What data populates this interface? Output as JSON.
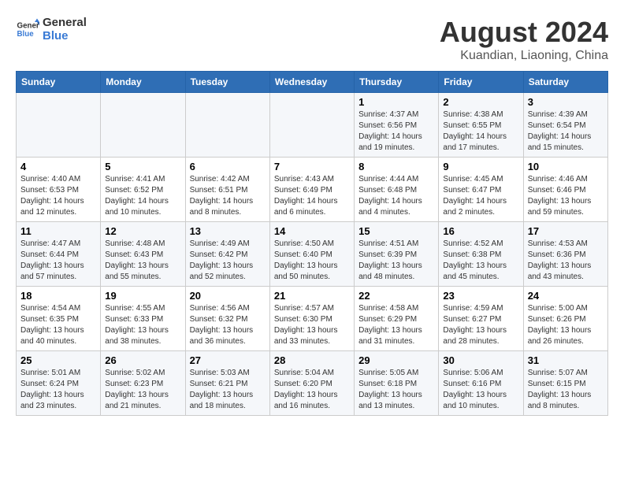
{
  "header": {
    "logo_line1": "General",
    "logo_line2": "Blue",
    "month_title": "August 2024",
    "location": "Kuandian, Liaoning, China"
  },
  "weekdays": [
    "Sunday",
    "Monday",
    "Tuesday",
    "Wednesday",
    "Thursday",
    "Friday",
    "Saturday"
  ],
  "weeks": [
    [
      {
        "day": "",
        "info": ""
      },
      {
        "day": "",
        "info": ""
      },
      {
        "day": "",
        "info": ""
      },
      {
        "day": "",
        "info": ""
      },
      {
        "day": "1",
        "info": "Sunrise: 4:37 AM\nSunset: 6:56 PM\nDaylight: 14 hours\nand 19 minutes."
      },
      {
        "day": "2",
        "info": "Sunrise: 4:38 AM\nSunset: 6:55 PM\nDaylight: 14 hours\nand 17 minutes."
      },
      {
        "day": "3",
        "info": "Sunrise: 4:39 AM\nSunset: 6:54 PM\nDaylight: 14 hours\nand 15 minutes."
      }
    ],
    [
      {
        "day": "4",
        "info": "Sunrise: 4:40 AM\nSunset: 6:53 PM\nDaylight: 14 hours\nand 12 minutes."
      },
      {
        "day": "5",
        "info": "Sunrise: 4:41 AM\nSunset: 6:52 PM\nDaylight: 14 hours\nand 10 minutes."
      },
      {
        "day": "6",
        "info": "Sunrise: 4:42 AM\nSunset: 6:51 PM\nDaylight: 14 hours\nand 8 minutes."
      },
      {
        "day": "7",
        "info": "Sunrise: 4:43 AM\nSunset: 6:49 PM\nDaylight: 14 hours\nand 6 minutes."
      },
      {
        "day": "8",
        "info": "Sunrise: 4:44 AM\nSunset: 6:48 PM\nDaylight: 14 hours\nand 4 minutes."
      },
      {
        "day": "9",
        "info": "Sunrise: 4:45 AM\nSunset: 6:47 PM\nDaylight: 14 hours\nand 2 minutes."
      },
      {
        "day": "10",
        "info": "Sunrise: 4:46 AM\nSunset: 6:46 PM\nDaylight: 13 hours\nand 59 minutes."
      }
    ],
    [
      {
        "day": "11",
        "info": "Sunrise: 4:47 AM\nSunset: 6:44 PM\nDaylight: 13 hours\nand 57 minutes."
      },
      {
        "day": "12",
        "info": "Sunrise: 4:48 AM\nSunset: 6:43 PM\nDaylight: 13 hours\nand 55 minutes."
      },
      {
        "day": "13",
        "info": "Sunrise: 4:49 AM\nSunset: 6:42 PM\nDaylight: 13 hours\nand 52 minutes."
      },
      {
        "day": "14",
        "info": "Sunrise: 4:50 AM\nSunset: 6:40 PM\nDaylight: 13 hours\nand 50 minutes."
      },
      {
        "day": "15",
        "info": "Sunrise: 4:51 AM\nSunset: 6:39 PM\nDaylight: 13 hours\nand 48 minutes."
      },
      {
        "day": "16",
        "info": "Sunrise: 4:52 AM\nSunset: 6:38 PM\nDaylight: 13 hours\nand 45 minutes."
      },
      {
        "day": "17",
        "info": "Sunrise: 4:53 AM\nSunset: 6:36 PM\nDaylight: 13 hours\nand 43 minutes."
      }
    ],
    [
      {
        "day": "18",
        "info": "Sunrise: 4:54 AM\nSunset: 6:35 PM\nDaylight: 13 hours\nand 40 minutes."
      },
      {
        "day": "19",
        "info": "Sunrise: 4:55 AM\nSunset: 6:33 PM\nDaylight: 13 hours\nand 38 minutes."
      },
      {
        "day": "20",
        "info": "Sunrise: 4:56 AM\nSunset: 6:32 PM\nDaylight: 13 hours\nand 36 minutes."
      },
      {
        "day": "21",
        "info": "Sunrise: 4:57 AM\nSunset: 6:30 PM\nDaylight: 13 hours\nand 33 minutes."
      },
      {
        "day": "22",
        "info": "Sunrise: 4:58 AM\nSunset: 6:29 PM\nDaylight: 13 hours\nand 31 minutes."
      },
      {
        "day": "23",
        "info": "Sunrise: 4:59 AM\nSunset: 6:27 PM\nDaylight: 13 hours\nand 28 minutes."
      },
      {
        "day": "24",
        "info": "Sunrise: 5:00 AM\nSunset: 6:26 PM\nDaylight: 13 hours\nand 26 minutes."
      }
    ],
    [
      {
        "day": "25",
        "info": "Sunrise: 5:01 AM\nSunset: 6:24 PM\nDaylight: 13 hours\nand 23 minutes."
      },
      {
        "day": "26",
        "info": "Sunrise: 5:02 AM\nSunset: 6:23 PM\nDaylight: 13 hours\nand 21 minutes."
      },
      {
        "day": "27",
        "info": "Sunrise: 5:03 AM\nSunset: 6:21 PM\nDaylight: 13 hours\nand 18 minutes."
      },
      {
        "day": "28",
        "info": "Sunrise: 5:04 AM\nSunset: 6:20 PM\nDaylight: 13 hours\nand 16 minutes."
      },
      {
        "day": "29",
        "info": "Sunrise: 5:05 AM\nSunset: 6:18 PM\nDaylight: 13 hours\nand 13 minutes."
      },
      {
        "day": "30",
        "info": "Sunrise: 5:06 AM\nSunset: 6:16 PM\nDaylight: 13 hours\nand 10 minutes."
      },
      {
        "day": "31",
        "info": "Sunrise: 5:07 AM\nSunset: 6:15 PM\nDaylight: 13 hours\nand 8 minutes."
      }
    ]
  ]
}
